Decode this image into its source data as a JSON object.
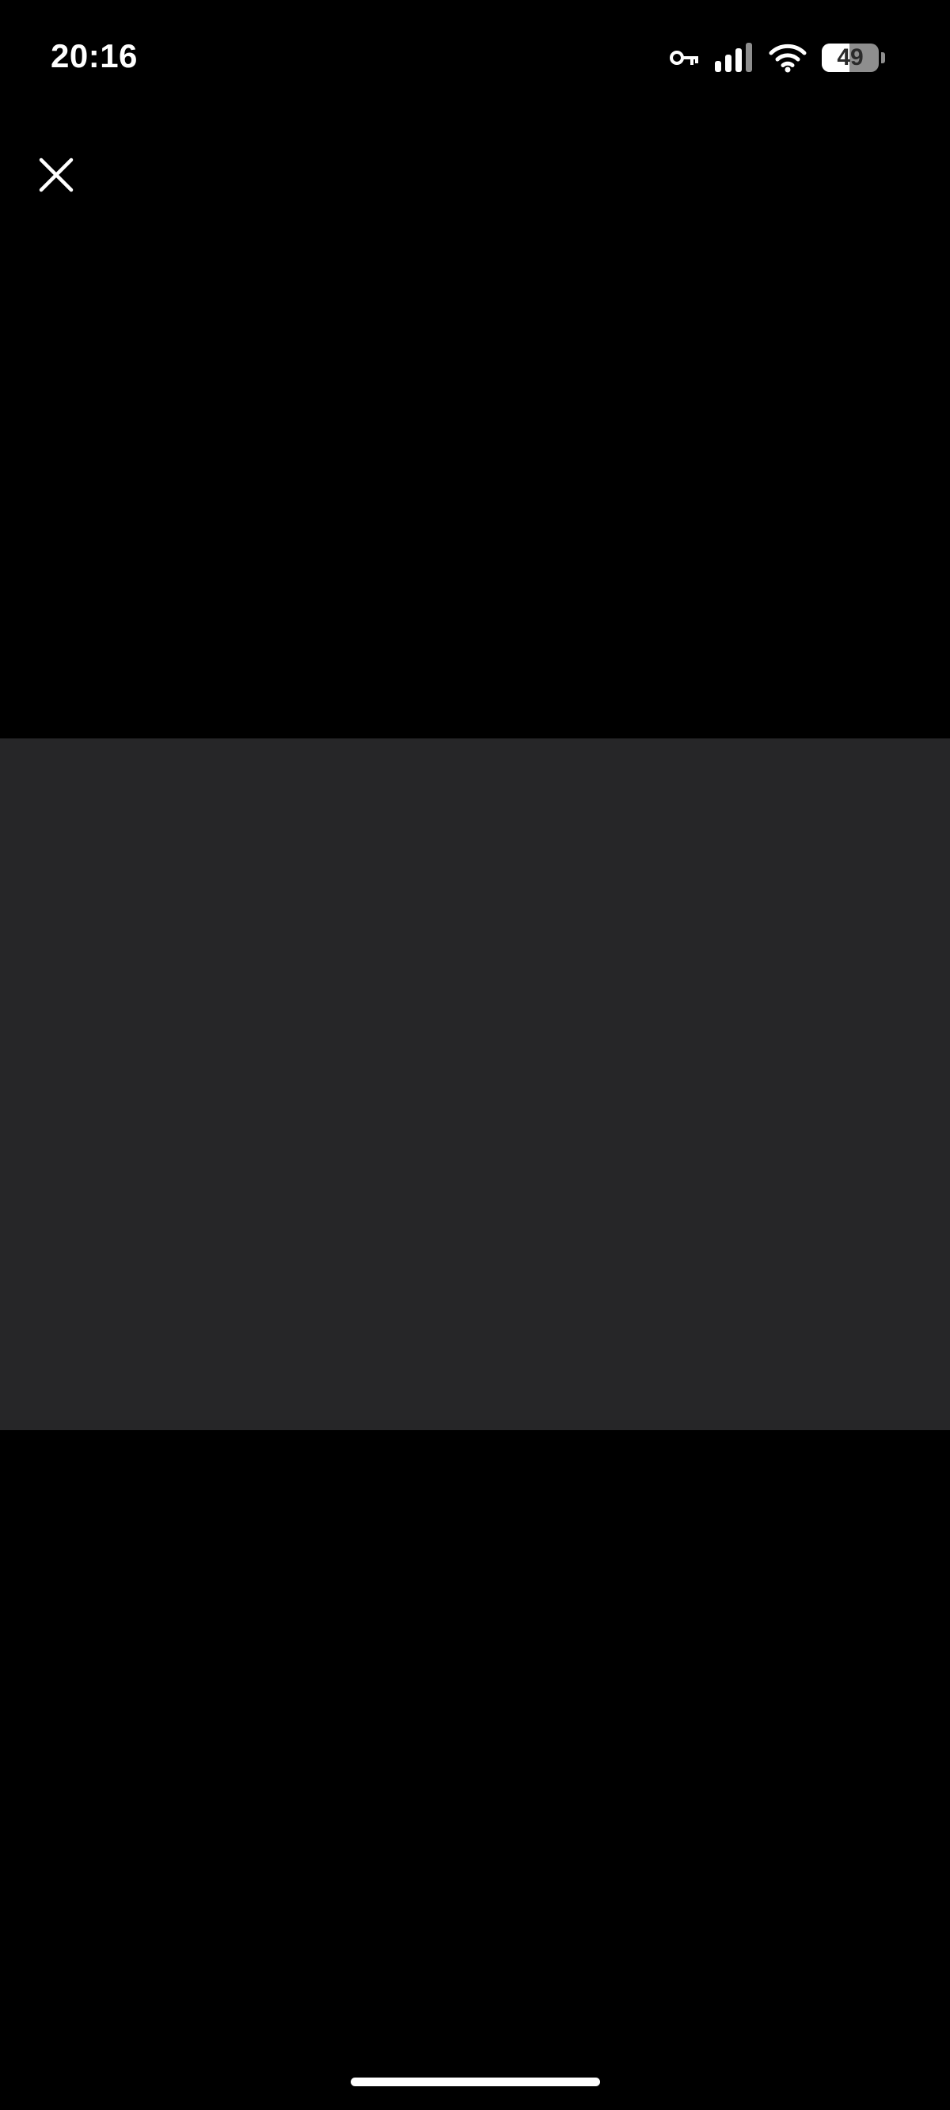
{
  "status_bar": {
    "time": "20:16",
    "icons": [
      "vpn-key-icon",
      "cellular-signal-icon",
      "wifi-icon",
      "battery-icon"
    ],
    "battery_level": "49",
    "battery_fraction": 0.49
  },
  "toolbar": {
    "close_icon": "close-icon"
  },
  "media_viewer": {
    "placeholder_color": "#262628"
  },
  "colors": {
    "background": "#000000",
    "foreground": "#ffffff",
    "media_placeholder": "#262628",
    "battery_empty": "#8e8e8e"
  }
}
